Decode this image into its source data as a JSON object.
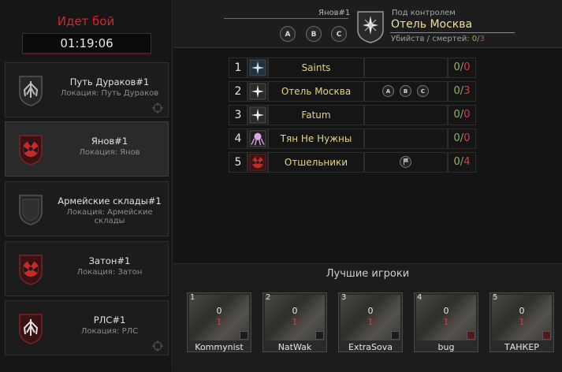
{
  "battle": {
    "status": "Идет бой",
    "timer": "01:19:06"
  },
  "locations": [
    {
      "title": "Путь Дураков#1",
      "subtitle": "Локация: Путь Дураков",
      "emblem": "wings-emblem-icon",
      "selected": false
    },
    {
      "title": "Янов#1",
      "subtitle": "Локация: Янов",
      "emblem": "radiation-emblem-icon",
      "selected": true
    },
    {
      "title": "Армейские склады#1",
      "subtitle": "Локация: Армейские склады",
      "emblem": "empty-shield-icon",
      "selected": false
    },
    {
      "title": "Затон#1",
      "subtitle": "Локация: Затон",
      "emblem": "radiation-emblem-icon",
      "selected": false
    },
    {
      "title": "РЛС#1",
      "subtitle": "Локация: РЛС",
      "emblem": "wings-emblem-icon",
      "selected": false
    }
  ],
  "header": {
    "location": "Янов#1",
    "pills": [
      "A",
      "B",
      "C"
    ],
    "control_label": "Под контролем",
    "control_name": "Отель Москва",
    "kd_label": "Убийств / смертей:",
    "kd_kills": "0",
    "kd_deaths": "3"
  },
  "standings": [
    {
      "rank": "1",
      "name": "Saints",
      "emblem": "compass-star-icon",
      "points": [],
      "kills": "0",
      "deaths": "0"
    },
    {
      "rank": "2",
      "name": "Отель Москва",
      "emblem": "compass-star-icon",
      "points": [
        "A",
        "B",
        "C"
      ],
      "kills": "0",
      "deaths": "3"
    },
    {
      "rank": "3",
      "name": "Fatum",
      "emblem": "compass-star-icon",
      "points": [],
      "kills": "0",
      "deaths": "0"
    },
    {
      "rank": "4",
      "name": "Тян Не Нужны",
      "emblem": "octopus-icon",
      "points": [],
      "kills": "0",
      "deaths": "0"
    },
    {
      "rank": "5",
      "name": "Отшельники",
      "emblem": "radiation-emblem-icon",
      "points": [
        "flag"
      ],
      "kills": "0",
      "deaths": "4"
    }
  ],
  "best_players": {
    "title": "Лучшие игроки",
    "players": [
      {
        "rank": "1",
        "name": "Kommynist",
        "kills": "0",
        "deaths": "1"
      },
      {
        "rank": "2",
        "name": "NatWak",
        "kills": "0",
        "deaths": "1"
      },
      {
        "rank": "3",
        "name": "ExtraSova",
        "kills": "0",
        "deaths": "1"
      },
      {
        "rank": "4",
        "name": "bug",
        "kills": "0",
        "deaths": "1"
      },
      {
        "rank": "5",
        "name": "ТАНКЕР",
        "kills": "0",
        "deaths": "1"
      }
    ]
  },
  "colors": {
    "accent_red": "#d7262b",
    "gold": "#e8d27c",
    "kills_green": "#8fb84b",
    "deaths_red": "#d04040"
  }
}
